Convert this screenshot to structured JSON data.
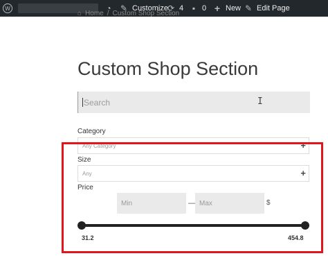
{
  "adminbar": {
    "customize_label": "Customize",
    "updates_count": "4",
    "comments_count": "0",
    "new_label": "New",
    "edit_label": "Edit Page"
  },
  "breadcrumb": {
    "home": "Home",
    "separator": "/",
    "current": "Custom Shop Section"
  },
  "page": {
    "title": "Custom Shop Section"
  },
  "search": {
    "placeholder": "Search"
  },
  "filters": {
    "category": {
      "label": "Category",
      "value": "Any Category"
    },
    "size": {
      "label": "Size",
      "value": "Any"
    },
    "price": {
      "label": "Price",
      "min_placeholder": "Min",
      "max_placeholder": "Max",
      "separator": "—",
      "currency": "$",
      "range_min": "31.2",
      "range_max": "454.8"
    }
  },
  "colors": {
    "adminbar_bg": "#23282d",
    "highlight": "#e3141a",
    "slider": "#222222"
  }
}
